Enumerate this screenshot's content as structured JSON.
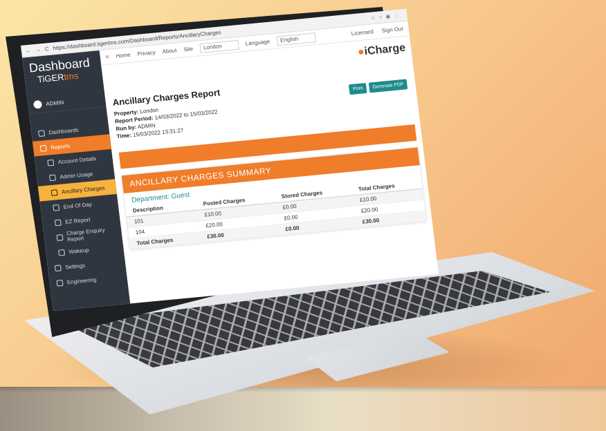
{
  "browser": {
    "url": "https://dashboard.tigertms.com/Dashboard/Reports/AncillaryCharges",
    "nav_glyphs": [
      "←",
      "→",
      "C"
    ]
  },
  "sidebar": {
    "logo_main": "Dashboard",
    "logo_sub_a": "TiGER",
    "logo_sub_b": "tms",
    "user": "ADMIN",
    "items": [
      {
        "label": "Dashboards"
      },
      {
        "label": "Reports"
      },
      {
        "label": "Account Details"
      },
      {
        "label": "Admin Usage"
      },
      {
        "label": "Ancillary Charges"
      },
      {
        "label": "End Of Day"
      },
      {
        "label": "EZ Report"
      },
      {
        "label": "Charge Enquiry Report"
      },
      {
        "label": "Wakeup"
      },
      {
        "label": "Settings"
      },
      {
        "label": "Engineering"
      }
    ]
  },
  "topbar": {
    "menu_icon": "≡",
    "home": "Home",
    "privacy": "Privacy",
    "about": "About",
    "site_label": "Site",
    "site_value": "London",
    "language_label": "Language",
    "language_value": "English",
    "licensed": "Licensed",
    "signout": "Sign Out"
  },
  "brand": {
    "name": "iCharge"
  },
  "report": {
    "title": "Ancillary Charges Report",
    "property_label": "Property:",
    "property": "London",
    "period_label": "Report Period:",
    "period": "14/03/2022 to 15/03/2022",
    "runby_label": "Run by:",
    "runby": "ADMIN",
    "time_label": "Time:",
    "time": "15/03/2022 13:31:27",
    "print_btn": "Print",
    "pdf_btn": "Generate PDF"
  },
  "summary": {
    "heading": "ANCILLARY CHARGES SUMMARY",
    "department": "Department: Guest",
    "columns": [
      "Description",
      "Posted Charges",
      "Stored Charges",
      "Total Charges"
    ],
    "rows": [
      [
        "101",
        "£10.00",
        "£0.00",
        "£10.00"
      ],
      [
        "104",
        "£20.00",
        "£0.00",
        "£20.00"
      ]
    ],
    "total": [
      "Total Charges",
      "£30.00",
      "£0.00",
      "£30.00"
    ]
  },
  "colors": {
    "accent": "#ef7d2a",
    "teal": "#1e8c8a",
    "sidebar": "#2f3640"
  }
}
